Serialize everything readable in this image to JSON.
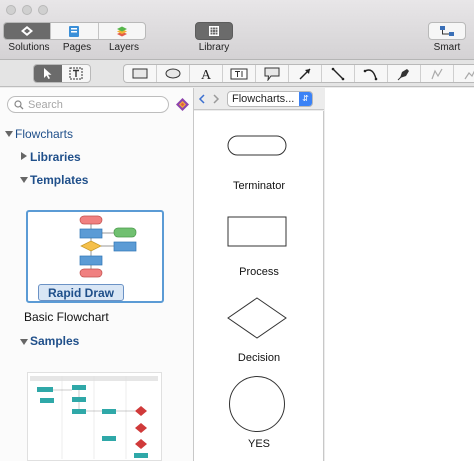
{
  "toolbar": {
    "solutions_label": "Solutions",
    "pages_label": "Pages",
    "layers_label": "Layers",
    "library_label": "Library",
    "smart_label": "Smart"
  },
  "sidebar": {
    "search_placeholder": "Search",
    "tree": {
      "root": "Flowcharts",
      "libraries": "Libraries",
      "templates": "Templates",
      "samples": "Samples"
    },
    "template_badge": "Rapid Draw",
    "template_name": "Basic Flowchart"
  },
  "library": {
    "selected": "Flowcharts...",
    "shapes": [
      {
        "label": "Terminator"
      },
      {
        "label": "Process"
      },
      {
        "label": "Decision"
      },
      {
        "label": "YES"
      }
    ]
  },
  "colors": {
    "accent": "#3b82f6",
    "tree_text": "#1f4f8a",
    "selected_border": "#5b9bd5"
  }
}
